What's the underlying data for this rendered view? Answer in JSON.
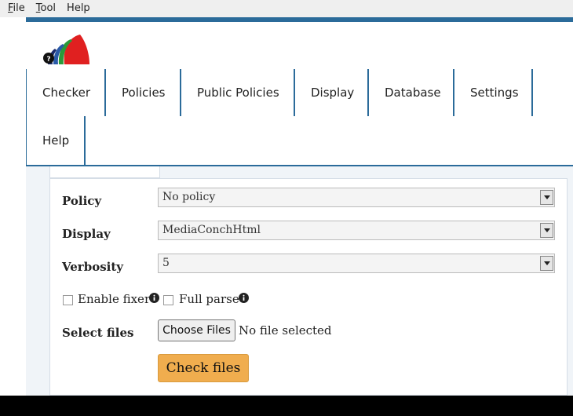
{
  "menubar": {
    "items": [
      {
        "label_pre": "",
        "label_ul": "F",
        "label_post": "ile"
      },
      {
        "label_pre": "",
        "label_ul": "T",
        "label_post": "ool"
      },
      {
        "label_pre": "",
        "label_ul": "",
        "label_post": "Help"
      }
    ]
  },
  "logo": {
    "icon": "mediaconch-logo-icon",
    "glyph": "?"
  },
  "nav": {
    "items": [
      "Checker",
      "Policies",
      "Public Policies",
      "Display",
      "Database",
      "Settings",
      "Help"
    ]
  },
  "form": {
    "policy_label": "Policy",
    "policy_value": "No policy",
    "display_label": "Display",
    "display_value": "MediaConchHtml",
    "verbosity_label": "Verbosity",
    "verbosity_value": "5",
    "fixer_label": "Enable fixer",
    "fullparse_label": "Full parse",
    "files_label": "Select files",
    "choose_files": "Choose Files",
    "no_file": "No file selected",
    "check_files": "Check files"
  },
  "colors": {
    "nav_border": "#2b6b9a",
    "check_button": "#f0ad4e"
  }
}
